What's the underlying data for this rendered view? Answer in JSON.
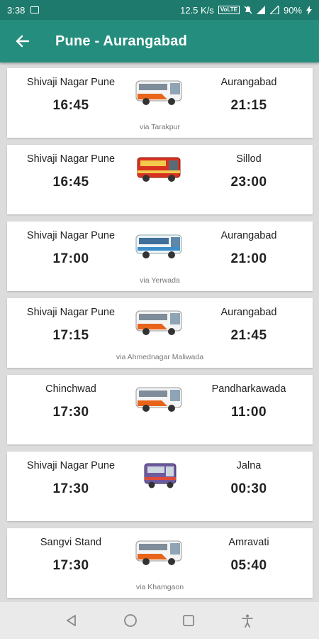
{
  "status_bar": {
    "time": "3:38",
    "net_speed": "12.5 K/s",
    "volte": "VoLTE",
    "battery": "90%"
  },
  "app_bar": {
    "title": "Pune - Aurangabad"
  },
  "colors": {
    "status_bar": "#1d7a6c",
    "app_bar": "#258d7d",
    "background": "#dcdcdc"
  },
  "trips": [
    {
      "from": "Shivaji Nagar Pune",
      "depart": "16:45",
      "to": "Aurangabad",
      "arrive": "21:15",
      "via": "via Tarakpur",
      "bus": "white-orange-bus"
    },
    {
      "from": "Shivaji Nagar Pune",
      "depart": "16:45",
      "to": "Sillod",
      "arrive": "23:00",
      "via": "",
      "bus": "red-bus"
    },
    {
      "from": "Shivaji Nagar Pune",
      "depart": "17:00",
      "to": "Aurangabad",
      "arrive": "21:00",
      "via": "via Yerwada",
      "bus": "blue-bus"
    },
    {
      "from": "Shivaji Nagar Pune",
      "depart": "17:15",
      "to": "Aurangabad",
      "arrive": "21:45",
      "via": "via Ahmednagar Maliwada",
      "bus": "white-orange-bus"
    },
    {
      "from": "Chinchwad",
      "depart": "17:30",
      "to": "Pandharkawada",
      "arrive": "11:00",
      "via": "",
      "bus": "white-orange-bus"
    },
    {
      "from": "Shivaji Nagar Pune",
      "depart": "17:30",
      "to": "Jalna",
      "arrive": "00:30",
      "via": "",
      "bus": "purple-bus"
    },
    {
      "from": "Sangvi Stand",
      "depart": "17:30",
      "to": "Amravati",
      "arrive": "05:40",
      "via": "via Khamgaon",
      "bus": "white-orange-bus"
    }
  ]
}
